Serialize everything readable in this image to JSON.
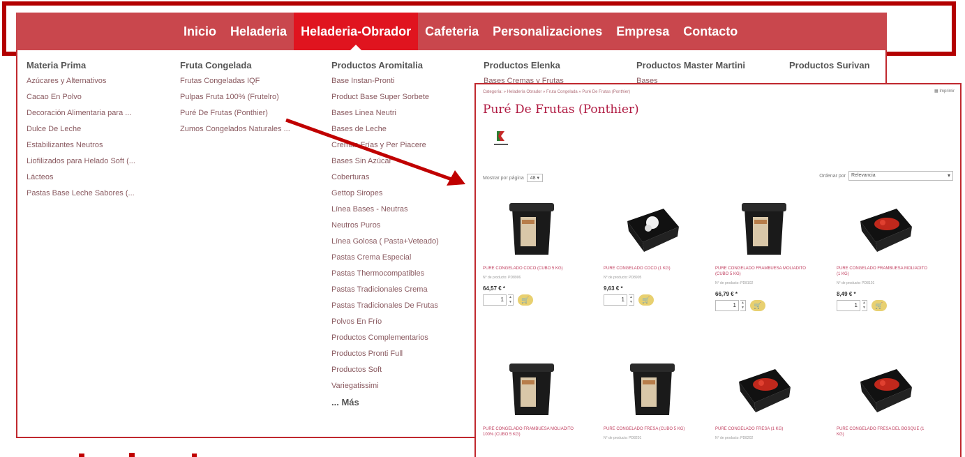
{
  "nav": {
    "items": [
      "Inicio",
      "Heladeria",
      "Heladeria-Obrador",
      "Cafeteria",
      "Personalizaciones",
      "Empresa",
      "Contacto"
    ],
    "active_index": 2
  },
  "menu": {
    "columns": [
      {
        "title": "Materia Prima",
        "items": [
          "Azúcares y Alternativos",
          "Cacao En Polvo",
          "Decoración Alimentaria para ...",
          "Dulce De Leche",
          "Estabilizantes Neutros",
          "Liofilizados para Helado Soft (...",
          "Lácteos",
          "Pastas Base Leche Sabores (..."
        ]
      },
      {
        "title": "Fruta Congelada",
        "items": [
          "Frutas Congeladas IQF",
          "Pulpas Fruta 100% (Frutelro)",
          "Puré De Frutas (Ponthier)",
          "Zumos Congelados Naturales ..."
        ]
      },
      {
        "title": "Productos Aromitalia",
        "items": [
          "Base Instan-Pronti",
          "Product Base Super Sorbete",
          "Bases Linea Neutri",
          "Bases de Leche",
          "Cremas Frías y Per Piacere",
          "Bases Sin Azúcar",
          "Coberturas",
          "Gettop Siropes",
          "Línea Bases - Neutras",
          "Neutros Puros",
          "Línea Golosa ( Pasta+Veteado)",
          "Pastas Crema Especial",
          "Pastas Thermocompatibles",
          "Pastas Tradicionales Crema",
          "Pastas Tradicionales De Frutas",
          "Polvos En Frío",
          "Productos Complementarios",
          "Productos Pronti Full",
          "Productos Soft",
          "Variegatissimi"
        ],
        "more": "... Más"
      },
      {
        "title": "Productos Elenka",
        "items": [
          "Bases Cremas y Frutas"
        ]
      },
      {
        "title": "Productos Master Martini",
        "items": [
          "Bases"
        ]
      },
      {
        "title": "Productos Surivan",
        "items": []
      }
    ]
  },
  "category_page": {
    "breadcrumb": "Categoría: » Heladería Obrador » Fruta Congelada » Puré De Frutas (Ponthier)",
    "print_label": "Imprimir",
    "title": "Puré De Frutas (Ponthier)",
    "show_label": "Mostrar por página",
    "show_value": "48",
    "sort_label": "Ordenar por",
    "sort_value": "Relevancia",
    "products": [
      {
        "name": "PURE CONGELADO COCO (CUBO 5 KG)",
        "article": "N° de producto: PD8906",
        "price": "64,57 € *",
        "qty": "1",
        "package": "tub-cream"
      },
      {
        "name": "PURE CONGELADO COCO (1 KG)",
        "article": "N° de producto: PD8905",
        "price": "9,63 € *",
        "qty": "1",
        "package": "tray-white"
      },
      {
        "name": "PURE CONGELADO FRAMBUESA MOLIADITO (CUBO 5 KG)",
        "article": "N° de producto: PD8102",
        "price": "66,79 € *",
        "qty": "1",
        "package": "tub-cream"
      },
      {
        "name": "PURE CONGELADO FRAMBUESA MOLIADITO (1 KG)",
        "article": "N° de producto: PD8101",
        "price": "8,49 € *",
        "qty": "1",
        "package": "tray-red"
      },
      {
        "name": "PURE CONGELADO FRAMBUESA MOLIADITO 100% (CUBO 5 KG)",
        "article": "",
        "price": "",
        "qty": "",
        "package": "tub-cream"
      },
      {
        "name": "PURE CONGELADO FRESA (CUBO 5 KG)",
        "article": "N° de producto: PD8201",
        "price": "",
        "qty": "",
        "package": "tub-cream"
      },
      {
        "name": "PURE CONGELADO FRESA (1 KG)",
        "article": "N° de producto: PD8202",
        "price": "",
        "qty": "",
        "package": "tray-red"
      },
      {
        "name": "PURE CONGELADO FRESA DEL BOSQUE (1 KG)",
        "article": "",
        "price": "",
        "qty": "",
        "package": "tray-red"
      }
    ]
  },
  "colors": {
    "nav_bg": "#c9474d",
    "nav_active": "#e0141f",
    "frame": "#b30000",
    "title_red": "#b01a42"
  }
}
